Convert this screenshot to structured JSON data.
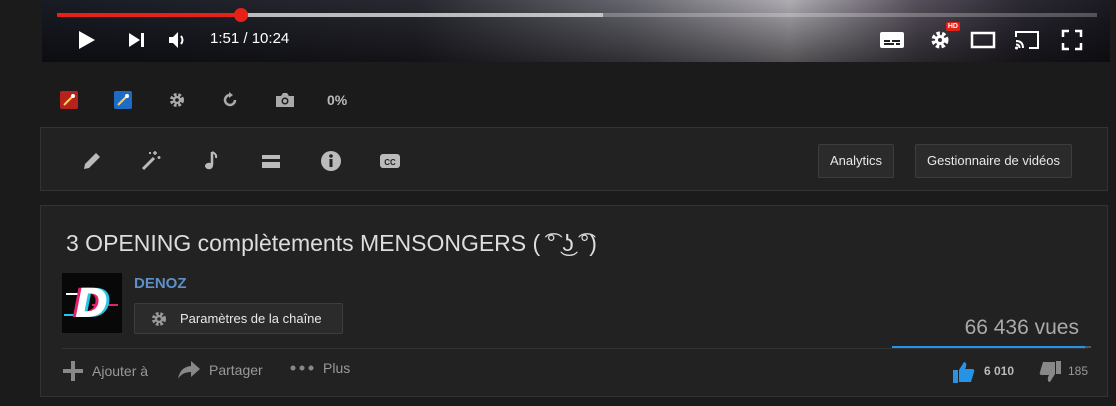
{
  "player": {
    "current_time": "1:51",
    "separator": "/",
    "duration": "10:24",
    "played_fraction": 0.177,
    "buffered_fraction": 0.525,
    "hd_badge": "HD",
    "colors": {
      "progress": "#e62117",
      "buffer": "#c8c8c8"
    }
  },
  "extension_bar": {
    "percent": "0%",
    "icons": [
      "red-magic-wand-icon",
      "blue-magic-wand-icon",
      "gear-icon",
      "loop-icon",
      "camera-icon"
    ]
  },
  "tools": {
    "icons": [
      "pencil-icon",
      "magic-wand-icon",
      "music-note-icon",
      "card-icon",
      "info-icon",
      "cc-icon"
    ],
    "analytics_label": "Analytics",
    "video_manager_label": "Gestionnaire de vidéos"
  },
  "video": {
    "title": "3 OPENING complètements MENSONGERS ( ͡° ͜ʖ ͡°)",
    "channel_name": "DENOZ",
    "avatar_letter": "D",
    "channel_settings_label": "Paramètres de la chaîne",
    "views": "66 436 vues",
    "like_fraction": 0.97,
    "add_to_label": "Ajouter à",
    "share_label": "Partager",
    "more_label": "Plus",
    "likes": "6 010",
    "dislikes": "185",
    "colors": {
      "channel": "#5e8fc7",
      "like": "#2793e6"
    }
  }
}
